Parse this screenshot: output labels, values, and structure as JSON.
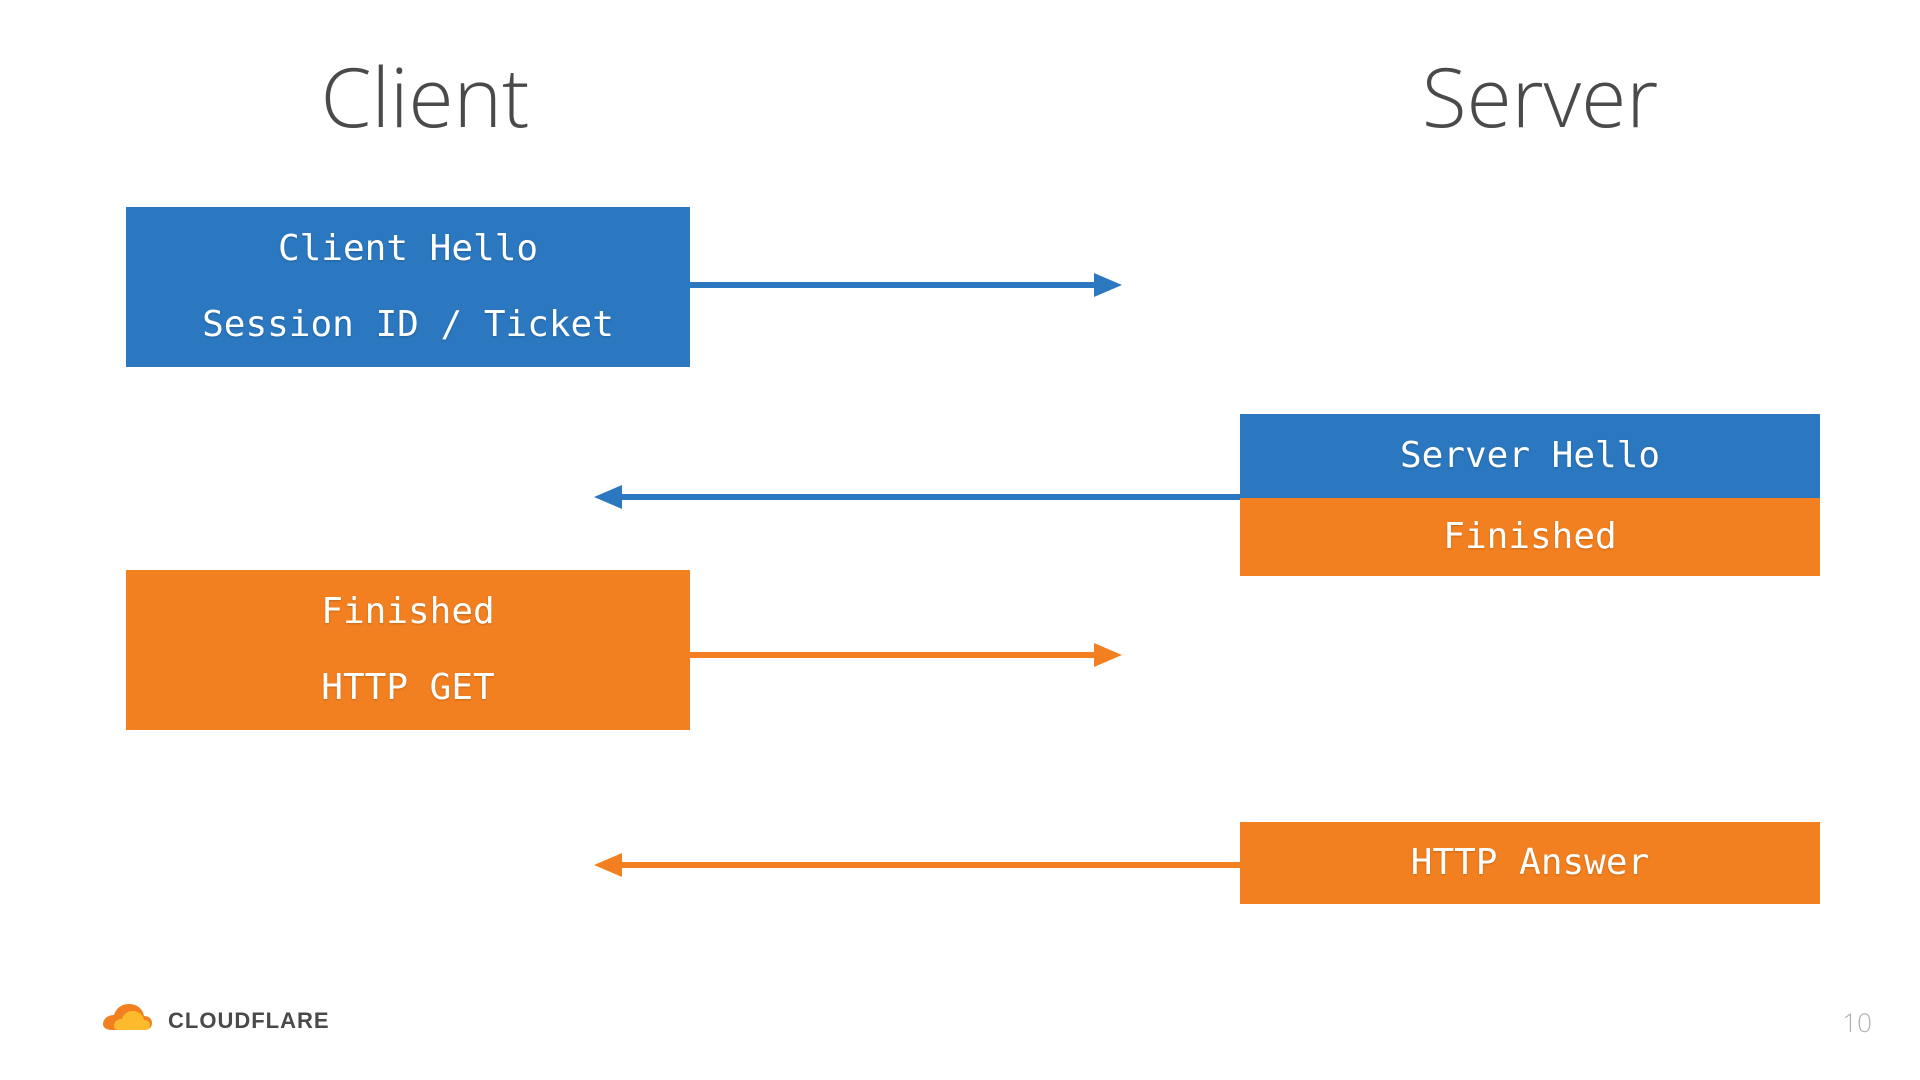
{
  "headings": {
    "client": "Client",
    "server": "Server"
  },
  "boxes": {
    "client_hello_l1": "Client Hello",
    "client_hello_l2": "Session ID / Ticket",
    "server_hello": "Server Hello",
    "server_finished": "Finished",
    "client_finished_l1": "Finished",
    "client_finished_l2": "HTTP GET",
    "http_answer": "HTTP Answer"
  },
  "footer": {
    "brand": "CLOUDFLARE",
    "page": "10"
  },
  "colors": {
    "blue": "#2B78C1",
    "orange": "#F38020"
  }
}
